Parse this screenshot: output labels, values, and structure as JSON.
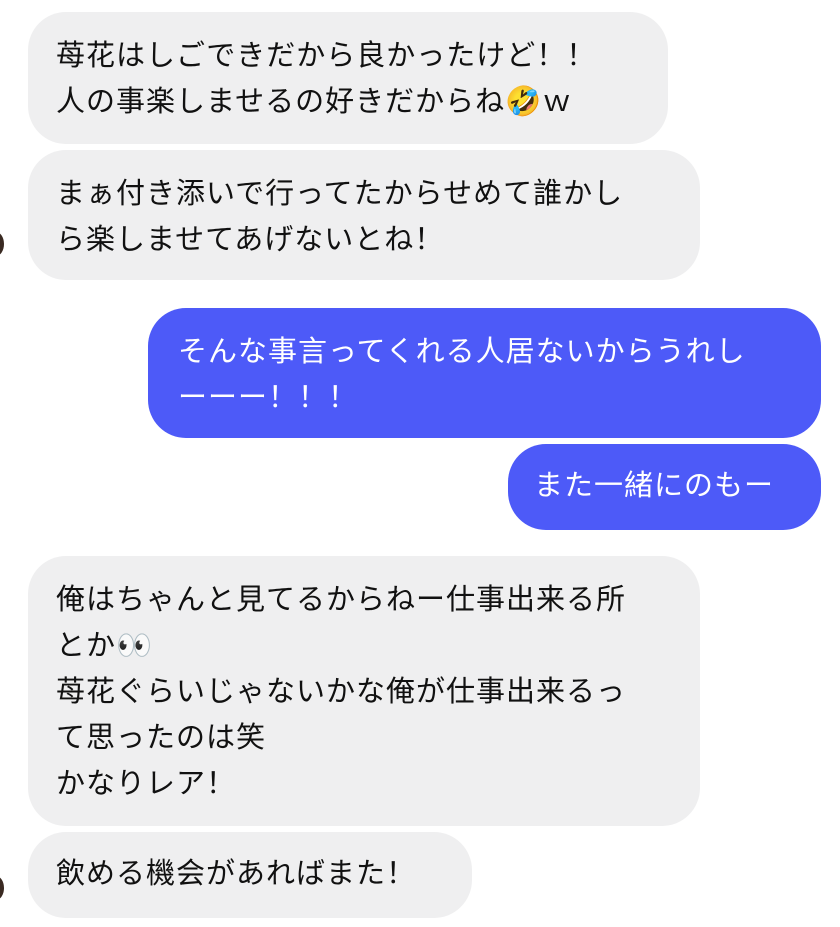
{
  "messages": [
    {
      "text": "苺花はしごできだから良かったけど！！\n人の事楽しませるの好きだからね🤣ｗ"
    },
    {
      "text": "まぁ付き添いで行ってたからせめて誰かし\nら楽しませてあげないとね！"
    },
    {
      "text": "そんな事言ってくれる人居ないからうれし\nーーー！！！"
    },
    {
      "text": "また一緒にのもー"
    },
    {
      "text": "俺はちゃんと見てるからねー仕事出来る所\nとか👀\n苺花ぐらいじゃないかな俺が仕事出来るっ\nて思ったのは笑\nかなりレア！"
    },
    {
      "text": "飲める機会があればまた！"
    }
  ]
}
